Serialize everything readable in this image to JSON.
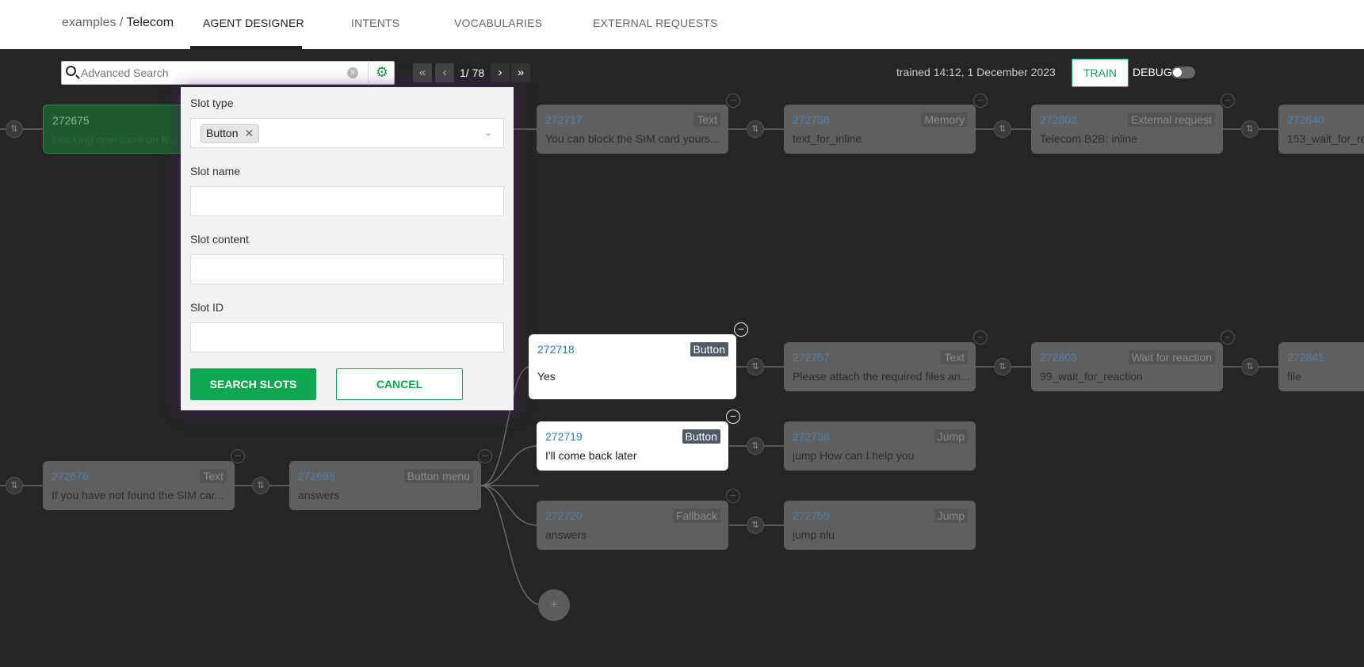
{
  "header": {
    "breadcrumb_project": "examples /",
    "breadcrumb_agent": "Telecom",
    "tabs": [
      {
        "label": "AGENT DESIGNER"
      },
      {
        "label": "INTENTS"
      },
      {
        "label": "VOCABULARIES"
      },
      {
        "label": "EXTERNAL REQUESTS"
      }
    ]
  },
  "toolbar": {
    "search_placeholder": "Advanced Search",
    "pager_text": "1/ 78",
    "trained_text": "trained 14:12, 1 December 2023",
    "train_label": "TRAIN",
    "debug_label": "DEBUG"
  },
  "panel": {
    "slot_type_label": "Slot type",
    "slot_type_chip": "Button",
    "slot_name_label": "Slot name",
    "slot_content_label": "Slot content",
    "slot_id_label": "Slot ID",
    "search_button": "SEARCH SLOTS",
    "cancel_button": "CANCEL"
  },
  "nodes": {
    "n272675": {
      "id": "272675",
      "type": "",
      "text": "blocking operators on B..."
    },
    "n272717": {
      "id": "272717",
      "type": "Text",
      "text": "You can block the SIM card yours..."
    },
    "n272756": {
      "id": "272756",
      "type": "Memory",
      "text": "text_for_inline"
    },
    "n272802": {
      "id": "272802",
      "type": "External request",
      "text": "Telecom B2B: inline"
    },
    "n272840": {
      "id": "272840",
      "type": "",
      "text": "153_wait_for_re"
    },
    "n272718": {
      "id": "272718",
      "type": "Button",
      "text": "Yes"
    },
    "n272757": {
      "id": "272757",
      "type": "Text",
      "text": "Please attach the required files an..."
    },
    "n272803": {
      "id": "272803",
      "type": "Wait for reaction",
      "text": "99_wait_for_reaction"
    },
    "n272841": {
      "id": "272841",
      "type": "",
      "text": "file"
    },
    "n272719": {
      "id": "272719",
      "type": "Button",
      "text": "I'll come back later"
    },
    "n272758": {
      "id": "272758",
      "type": "Jump",
      "text": "jump How can I help you"
    },
    "n272676": {
      "id": "272676",
      "type": "Text",
      "text": "If you have not found the SIM car..."
    },
    "n272698": {
      "id": "272698",
      "type": "Button menu",
      "text": "answers"
    },
    "n272720": {
      "id": "272720",
      "type": "Fallback",
      "text": "answers"
    },
    "n272759": {
      "id": "272759",
      "type": "Jump",
      "text": "jump nlu"
    }
  },
  "add_symbol": "+"
}
